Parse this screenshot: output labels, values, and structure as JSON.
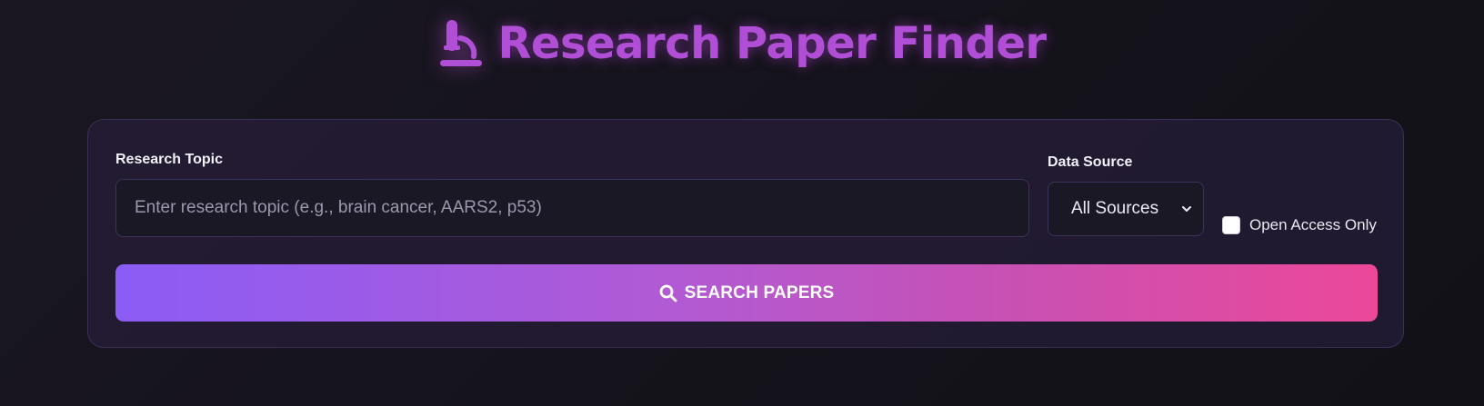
{
  "header": {
    "title": "Research Paper Finder",
    "icon": "microscope-icon"
  },
  "form": {
    "topic_label": "Research Topic",
    "topic_placeholder": "Enter research topic (e.g., brain cancer, AARS2, p53)",
    "topic_value": "",
    "source_label": "Data Source",
    "source_selected": "All Sources",
    "open_access_label": "Open Access Only",
    "open_access_checked": false,
    "search_button_label": "SEARCH PAPERS"
  },
  "colors": {
    "title": "#b04fd6",
    "button_gradient_start": "#8b5cf6",
    "button_gradient_end": "#ec4899",
    "background": "#15131b",
    "card": "#221b32"
  }
}
